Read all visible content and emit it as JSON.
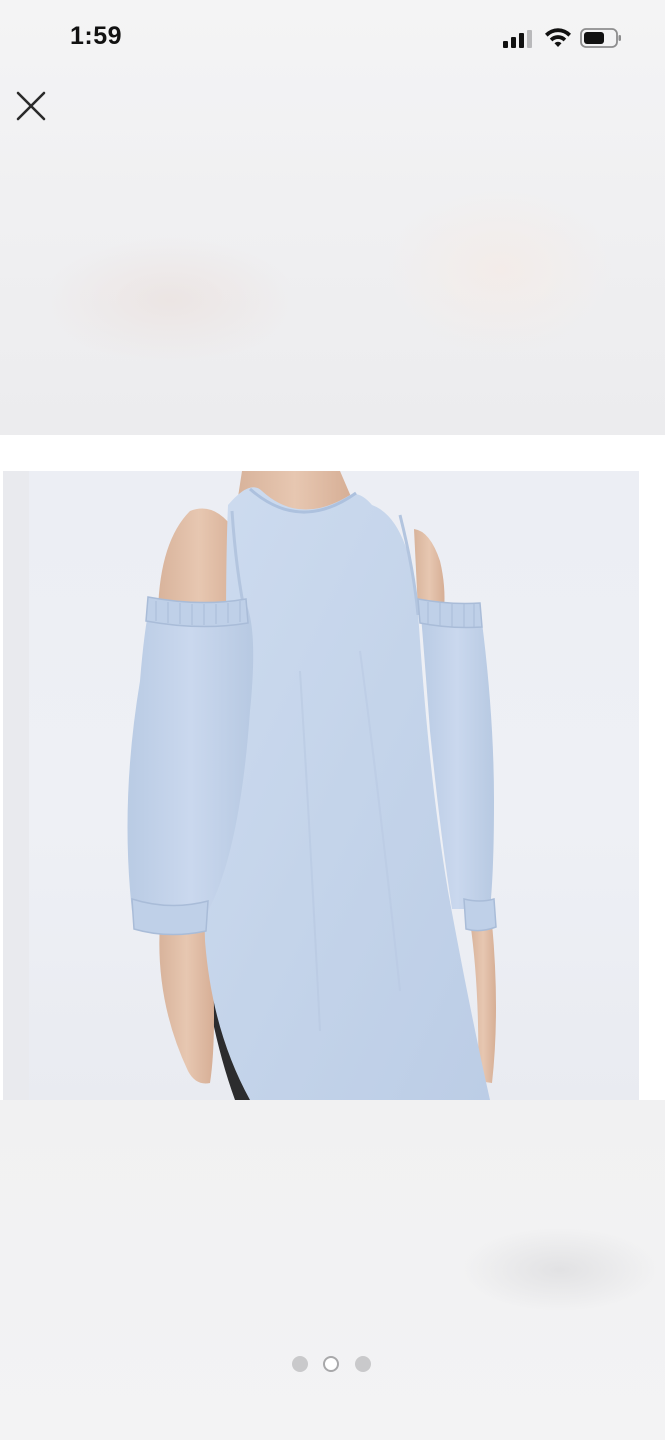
{
  "status_bar": {
    "time": "1:59",
    "signal_icon": "cellular-signal-icon",
    "wifi_icon": "wifi-icon",
    "battery_icon": "battery-icon"
  },
  "toolbar": {
    "close_icon": "close-icon"
  },
  "gallery": {
    "image_description_icon": "product-photo",
    "pager": {
      "count": 3,
      "active_index": 2
    }
  },
  "colors": {
    "shirt": "#c6d6ec",
    "skin": "#e2c0a8",
    "background": "#f2f2f3"
  }
}
